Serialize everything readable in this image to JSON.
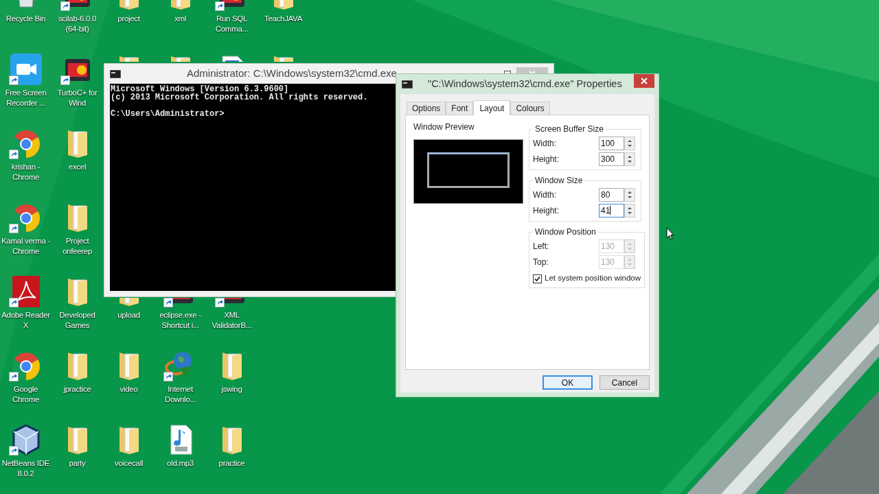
{
  "desktop": {
    "rows": [
      [
        {
          "label": "Recycle Bin",
          "kind": "recycle-bin",
          "shortcut": false,
          "partly_covered": false
        },
        {
          "label": "scilab-6.0.0 (64-bit)",
          "kind": "app",
          "shortcut": true,
          "partly_covered": false
        },
        {
          "label": "project",
          "kind": "folder",
          "shortcut": false,
          "partly_covered": false
        },
        {
          "label": "xml",
          "kind": "folder",
          "shortcut": false,
          "partly_covered": false
        },
        {
          "label": "Run SQL Comma...",
          "kind": "app",
          "shortcut": true,
          "partly_covered": false
        },
        {
          "label": "TeachJAVA",
          "kind": "folder",
          "shortcut": false,
          "partly_covered": false
        }
      ],
      [
        {
          "label": "Free Screen Recorder ...",
          "kind": "camera",
          "shortcut": true,
          "partly_covered": false
        },
        {
          "label": "TurboC+ for Wind",
          "kind": "app",
          "shortcut": true,
          "partly_covered": false
        },
        {
          "kind": "folder",
          "shortcut": false,
          "partly_covered": true
        },
        {
          "kind": "folder",
          "shortcut": false,
          "partly_covered": true
        },
        {
          "kind": "document",
          "shortcut": false,
          "partly_covered": true
        },
        {
          "kind": "folder",
          "shortcut": false,
          "partly_covered": true
        }
      ],
      [
        {
          "label": "krishan - Chrome",
          "kind": "browser",
          "shortcut": true,
          "partly_covered": false
        },
        {
          "label": "excel",
          "kind": "folder",
          "shortcut": false,
          "partly_covered": false
        }
      ],
      [
        {
          "label": "Kamal verma - Chrome",
          "kind": "browser",
          "shortcut": true,
          "partly_covered": false
        },
        {
          "label": "Project onfeerep",
          "kind": "folder",
          "shortcut": false,
          "partly_covered": false
        }
      ],
      [
        {
          "label": "Adobe Reader X",
          "kind": "pdf",
          "shortcut": true,
          "partly_covered": false
        },
        {
          "label": "Developed Games",
          "kind": "folder",
          "shortcut": false,
          "partly_covered": false
        },
        {
          "label": "upload",
          "kind": "folder",
          "shortcut": false,
          "partly_covered": true
        },
        {
          "label": "eclipse.exe - Shortcut i...",
          "kind": "app",
          "shortcut": true,
          "partly_covered": true
        },
        {
          "label": "XML ValidatorB...",
          "kind": "app",
          "shortcut": true,
          "partly_covered": true
        }
      ],
      [
        {
          "label": "Google Chrome",
          "kind": "browser",
          "shortcut": true,
          "partly_covered": false
        },
        {
          "label": "jpractice",
          "kind": "folder",
          "shortcut": false,
          "partly_covered": false
        },
        {
          "label": "video",
          "kind": "folder",
          "shortcut": false,
          "partly_covered": false
        },
        {
          "label": "Internet Downlo...",
          "kind": "globe",
          "shortcut": true,
          "partly_covered": false
        },
        {
          "label": "jswing",
          "kind": "folder",
          "shortcut": false,
          "partly_covered": false
        }
      ],
      [
        {
          "label": "NetBeans IDE 8.0.2",
          "kind": "cube",
          "shortcut": true,
          "partly_covered": false
        },
        {
          "label": "party",
          "kind": "folder",
          "shortcut": false,
          "partly_covered": false
        },
        {
          "label": "voicecall",
          "kind": "folder",
          "shortcut": false,
          "partly_covered": false
        },
        {
          "label": "old.mp3",
          "kind": "music",
          "shortcut": false,
          "partly_covered": false
        },
        {
          "label": "practice",
          "kind": "folder",
          "shortcut": false,
          "partly_covered": false
        }
      ]
    ]
  },
  "console_window": {
    "title": "Administrator: C:\\Windows\\system32\\cmd.exe",
    "lines": [
      {
        "text": "Microsoft Windows [Version 6.3.9600]",
        "gap_before": false
      },
      {
        "text": "(c) 2013 Microsoft Corporation. All rights reserved.",
        "gap_before": false
      },
      {
        "text": "C:\\Users\\Administrator>",
        "gap_before": true
      }
    ]
  },
  "dialog": {
    "title": "\"C:\\Windows\\system32\\cmd.exe\" Properties",
    "tabs": [
      {
        "label": "Options",
        "selected": false
      },
      {
        "label": "Font",
        "selected": false
      },
      {
        "label": "Layout",
        "selected": true
      },
      {
        "label": "Colours",
        "selected": false
      }
    ],
    "preview_label": "Window Preview",
    "groups": [
      {
        "title": "Screen Buffer Size",
        "fields": [
          {
            "label": "Width:",
            "value": "100",
            "disabled": false,
            "focused": false
          },
          {
            "label": "Height:",
            "value": "300",
            "disabled": false,
            "focused": false
          }
        ]
      },
      {
        "title": "Window Size",
        "fields": [
          {
            "label": "Width:",
            "value": "80",
            "disabled": false,
            "focused": false
          },
          {
            "label": "Height:",
            "value": "41",
            "disabled": false,
            "focused": true
          }
        ]
      },
      {
        "title": "Window Position",
        "fields": [
          {
            "label": "Left:",
            "value": "130",
            "disabled": true,
            "focused": false
          },
          {
            "label": "Top:",
            "value": "130",
            "disabled": true,
            "focused": false
          }
        ],
        "checkbox": {
          "label": "Let system position window",
          "checked": true
        }
      }
    ],
    "buttons": [
      {
        "label": "OK",
        "default": true
      },
      {
        "label": "Cancel",
        "default": false
      }
    ]
  }
}
